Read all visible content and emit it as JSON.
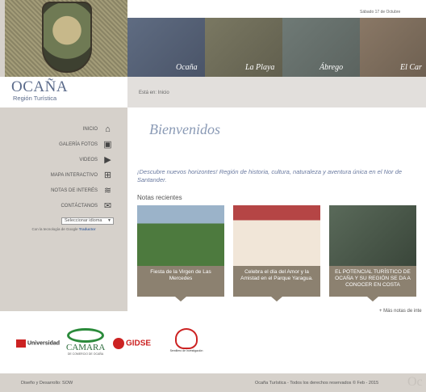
{
  "header": {
    "date": "Sábado 17 de Octubre"
  },
  "logo": {
    "title": "OCAÑA",
    "subtitle": "Región Turística"
  },
  "banner": [
    {
      "label": "Ocaña",
      "color": "#5f6c82"
    },
    {
      "label": "La Playa",
      "color": "#7a7862"
    },
    {
      "label": "Ábrego",
      "color": "#6f7a76"
    },
    {
      "label": "El Car",
      "color": "#8a7866"
    }
  ],
  "breadcrumb": {
    "text": "Está en: Inicio"
  },
  "menu": [
    {
      "label": "INICIO",
      "icon": "home-icon",
      "glyph": "⌂"
    },
    {
      "label": "GALERÍA FOTOS",
      "icon": "photo-icon",
      "glyph": "▣"
    },
    {
      "label": "VIDEOS",
      "icon": "video-icon",
      "glyph": "▶"
    },
    {
      "label": "MAPA INTERACTIVO",
      "icon": "map-icon",
      "glyph": "⊞"
    },
    {
      "label": "NOTAS DE INTERÉS",
      "icon": "rss-icon",
      "glyph": "≋"
    },
    {
      "label": "CONTÁCTANOS",
      "icon": "mail-icon",
      "glyph": "✉"
    }
  ],
  "translate": {
    "select": "Seleccionar idioma",
    "powered_prefix": "Con la tecnología de",
    "google": "Google",
    "powered_suffix": "Traductor"
  },
  "main": {
    "welcome": "Bienvenidos",
    "intro": "¡Descubre nuevos horizontes! Región de historia, cultura, naturaleza y aventura única en el Nor de Santander.",
    "notes_title": "Notas recientes",
    "more": "+ Más notas de inte"
  },
  "notes": [
    {
      "caption": "Fiesta de la Virgen de Las Mercedes",
      "color": "#3f7a3a"
    },
    {
      "caption": "Celebra el día del Amor y la Amistad en el Parque Yaragua.",
      "color": "#a33a3a"
    },
    {
      "caption": "EL POTENCIAL TURÍSTICO DE OCAÑA Y SU REGIÓN SE DA A CONOCER EN COSTA",
      "color": "#5a6a5a"
    }
  ],
  "sponsors": [
    {
      "name": "Universidad",
      "color": "#c22"
    },
    {
      "name": "CAMARA",
      "sub": "DE COMERCIO DE OCAÑA",
      "color": "#2a8a3a"
    },
    {
      "name": "GIDSE",
      "color": "#c22"
    },
    {
      "name": "Semillero de Investigación",
      "color": "#c22"
    }
  ],
  "footer": {
    "left": "Diseño y Desarrollo: SOW",
    "right": "Ocaña Turística - Todos los derechos reservados © Feb - 2015",
    "watermark": "Oc"
  }
}
